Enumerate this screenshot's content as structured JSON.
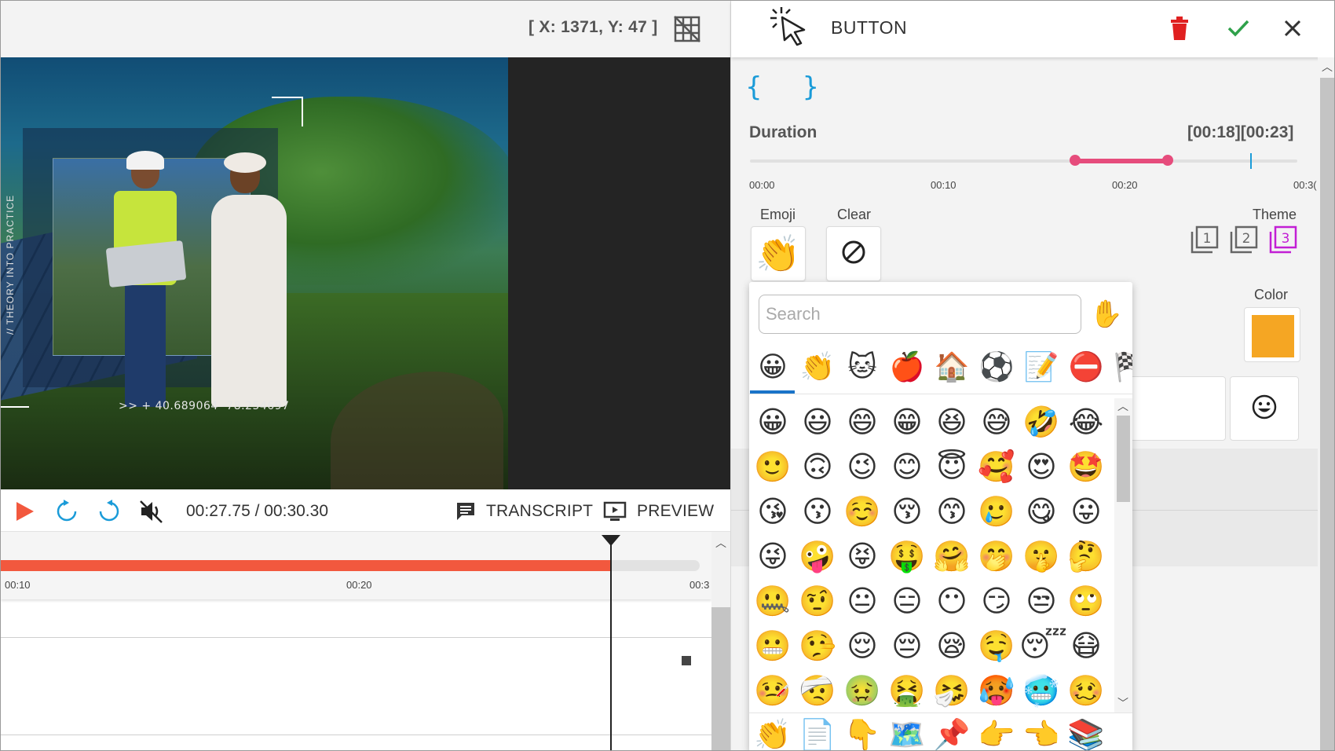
{
  "editor": {
    "coords": "[ X: 1371, Y: 47 ]",
    "player": {
      "timecode": "00:27.75 / 00:30.30",
      "transcript_label": "TRANSCRIPT",
      "preview_label": "PREVIEW",
      "progress_fraction": 0.916
    },
    "video_overlay": {
      "gps": ">> + 40.689064  -78.254697",
      "vertical_text": "// THEORY INTO PRACTICE"
    },
    "timeline": {
      "ticks": [
        "00:10",
        "00:20",
        "00:3"
      ]
    }
  },
  "panel": {
    "title": "BUTTON",
    "braces": "{ }",
    "duration": {
      "label": "Duration",
      "value": "[00:18][00:23]",
      "ticks": [
        "00:00",
        "00:10",
        "00:20",
        "00:3("
      ],
      "range_start": 18,
      "range_end": 23,
      "cursor": 28
    },
    "emoji_label": "Emoji",
    "clear_label": "Clear",
    "theme_label": "Theme",
    "color_label": "Color",
    "color_value": "#f5a623",
    "selected_emoji": "👏",
    "theme_options": [
      "1",
      "2",
      "3"
    ],
    "theme_selected": "3"
  },
  "picker": {
    "search_placeholder": "Search",
    "skin_tone": "✋",
    "categories": [
      "😀",
      "👏",
      "🐱",
      "🍎",
      "🏠",
      "⚽",
      "📝",
      "⛔",
      "🏁"
    ],
    "rows": [
      [
        "😀",
        "😃",
        "😄",
        "😁",
        "😆",
        "😅",
        "🤣",
        "😂"
      ],
      [
        "🙂",
        "🙃",
        "😉",
        "😊",
        "😇",
        "🥰",
        "😍",
        "🤩"
      ],
      [
        "😘",
        "😗",
        "☺️",
        "😚",
        "😙",
        "🥲",
        "😋",
        "😛"
      ],
      [
        "😜",
        "🤪",
        "😝",
        "🤑",
        "🤗",
        "🤭",
        "🤫",
        "🤔"
      ],
      [
        "🤐",
        "🤨",
        "😐",
        "😑",
        "😶",
        "😏",
        "😒",
        "🙄"
      ],
      [
        "😬",
        "🤥",
        "😌",
        "😔",
        "😪",
        "🤤",
        "😴",
        "😷"
      ],
      [
        "🤒",
        "🤕",
        "🤢",
        "🤮",
        "🤧",
        "🥵",
        "🥶",
        "🥴"
      ]
    ],
    "recent": [
      "👏",
      "📄",
      "👇",
      "🗺️",
      "📌",
      "👉",
      "👈",
      "📚"
    ]
  }
}
